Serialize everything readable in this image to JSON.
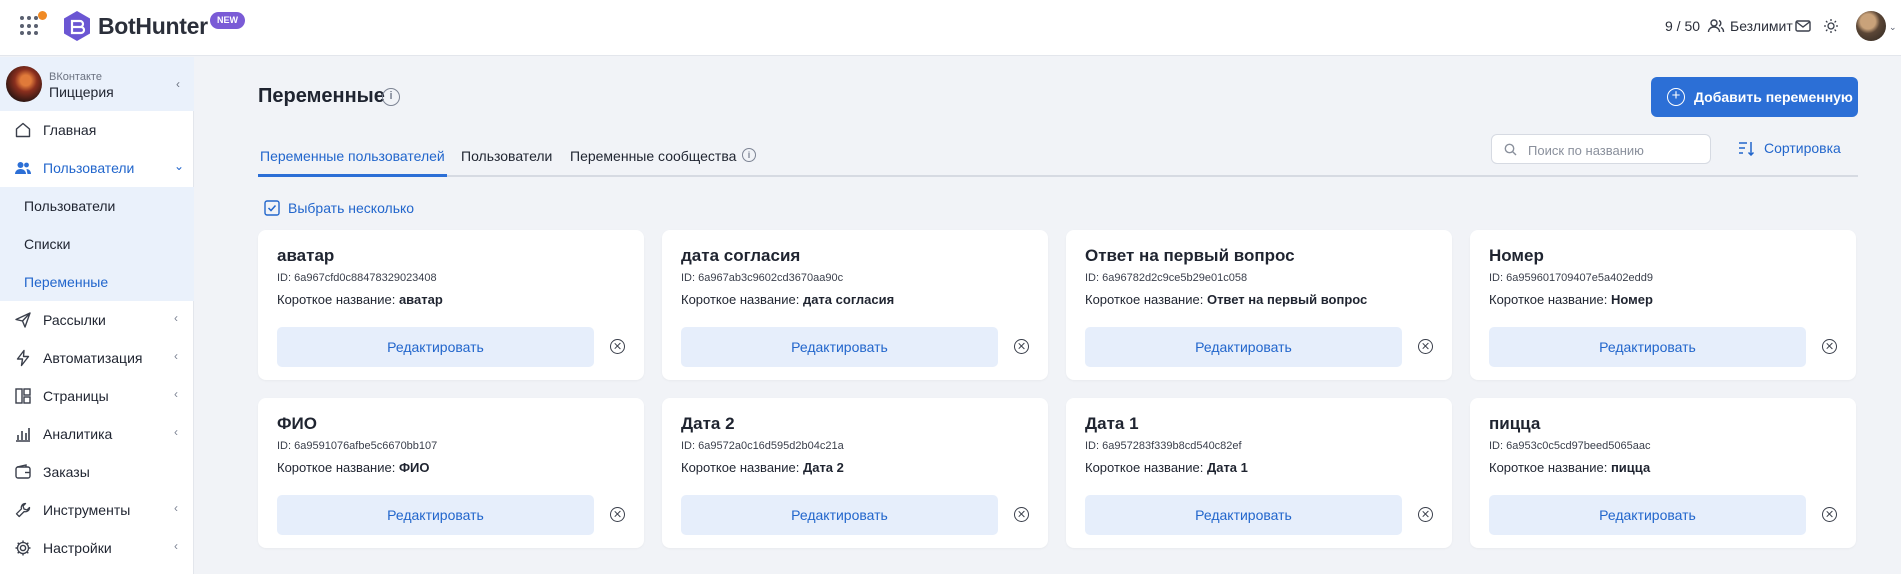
{
  "header": {
    "brand": "BotHunter",
    "badge": "NEW",
    "limit": "9 / 50",
    "plan": "Безлимит"
  },
  "sidebar": {
    "project": {
      "network": "ВКонтакте",
      "name": "Пиццерия"
    },
    "items": [
      {
        "label": "Главная",
        "icon": "home-icon"
      },
      {
        "label": "Пользователи",
        "icon": "users-icon",
        "active": true
      },
      {
        "label": "Рассылки",
        "icon": "send-icon"
      },
      {
        "label": "Автоматизация",
        "icon": "lightning-icon"
      },
      {
        "label": "Страницы",
        "icon": "pages-icon"
      },
      {
        "label": "Аналитика",
        "icon": "chart-icon"
      },
      {
        "label": "Заказы",
        "icon": "wallet-icon"
      },
      {
        "label": "Инструменты",
        "icon": "wrench-icon"
      },
      {
        "label": "Настройки",
        "icon": "gear-icon"
      }
    ],
    "subitems": [
      {
        "label": "Пользователи"
      },
      {
        "label": "Списки"
      },
      {
        "label": "Переменные",
        "active": true
      }
    ]
  },
  "main": {
    "title": "Переменные",
    "add_button": "Добавить переменную",
    "tabs": [
      {
        "label": "Переменные пользователей",
        "active": true
      },
      {
        "label": "Пользователи"
      },
      {
        "label": "Переменные сообщества"
      }
    ],
    "search_placeholder": "Поиск по названию",
    "sort_label": "Сортировка",
    "select_multiple": "Выбрать несколько",
    "id_prefix": "ID: ",
    "short_label": "Короткое название: ",
    "edit_label": "Редактировать",
    "cards": [
      {
        "name": "аватар",
        "id": "6a967cfd0c88478329023408",
        "short": "аватар"
      },
      {
        "name": "дата согласия",
        "id": "6a967ab3c9602cd3670aa90c",
        "short": "дата согласия"
      },
      {
        "name": "Ответ на первый вопрос",
        "id": "6a96782d2c9ce5b29e01c058",
        "short": "Ответ на первый вопрос"
      },
      {
        "name": "Номер",
        "id": "6a959601709407e5a402edd9",
        "short": "Номер"
      },
      {
        "name": "ФИО",
        "id": "6a9591076afbe5c6670bb107",
        "short": "ФИО"
      },
      {
        "name": "Дата 2",
        "id": "6a9572a0c16d595d2b04c21a",
        "short": "Дата 2"
      },
      {
        "name": "Дата 1",
        "id": "6a957283f339b8cd540c82ef",
        "short": "Дата 1"
      },
      {
        "name": "пицца",
        "id": "6a953c0c5cd97beed5065aac",
        "short": "пицца"
      }
    ]
  },
  "colors": {
    "accent": "#2c6fd6",
    "link": "#2266cc",
    "active_bg": "#eaf1fb",
    "page_bg": "#f1f3f7"
  }
}
